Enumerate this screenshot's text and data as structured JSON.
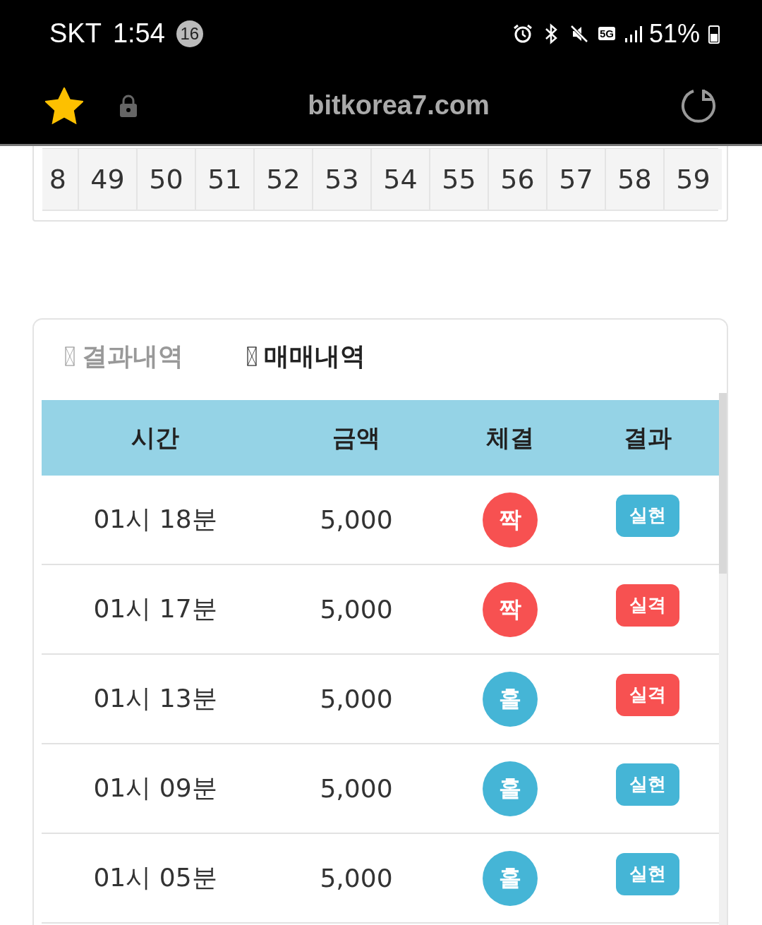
{
  "status_bar": {
    "carrier": "SKT",
    "time": "1:54",
    "notification_count": "16",
    "network": "5G",
    "battery": "51%"
  },
  "address_bar": {
    "bookmarked": true,
    "url": "bitkorea7.com"
  },
  "number_strip": [
    "8",
    "49",
    "50",
    "51",
    "52",
    "53",
    "54",
    "55",
    "56",
    "57",
    "58",
    "59"
  ],
  "tabs": [
    {
      "label": "결과내역",
      "selected": false
    },
    {
      "label": "매매내역",
      "selected": true
    }
  ],
  "table": {
    "columns": [
      "시간",
      "금액",
      "체결",
      "결과"
    ],
    "rows": [
      {
        "time": "01시 18분",
        "amount": "5,000",
        "fill": {
          "label": "짝",
          "color": "#f75151"
        },
        "result": {
          "label": "실현",
          "color": "#45b5d6"
        }
      },
      {
        "time": "01시 17분",
        "amount": "5,000",
        "fill": {
          "label": "짝",
          "color": "#f75151"
        },
        "result": {
          "label": "실격",
          "color": "#f75151"
        }
      },
      {
        "time": "01시 13분",
        "amount": "5,000",
        "fill": {
          "label": "홀",
          "color": "#45b5d6"
        },
        "result": {
          "label": "실격",
          "color": "#f75151"
        }
      },
      {
        "time": "01시 09분",
        "amount": "5,000",
        "fill": {
          "label": "홀",
          "color": "#45b5d6"
        },
        "result": {
          "label": "실현",
          "color": "#45b5d6"
        }
      },
      {
        "time": "01시 05분",
        "amount": "5,000",
        "fill": {
          "label": "홀",
          "color": "#45b5d6"
        },
        "result": {
          "label": "실현",
          "color": "#45b5d6"
        }
      }
    ]
  }
}
